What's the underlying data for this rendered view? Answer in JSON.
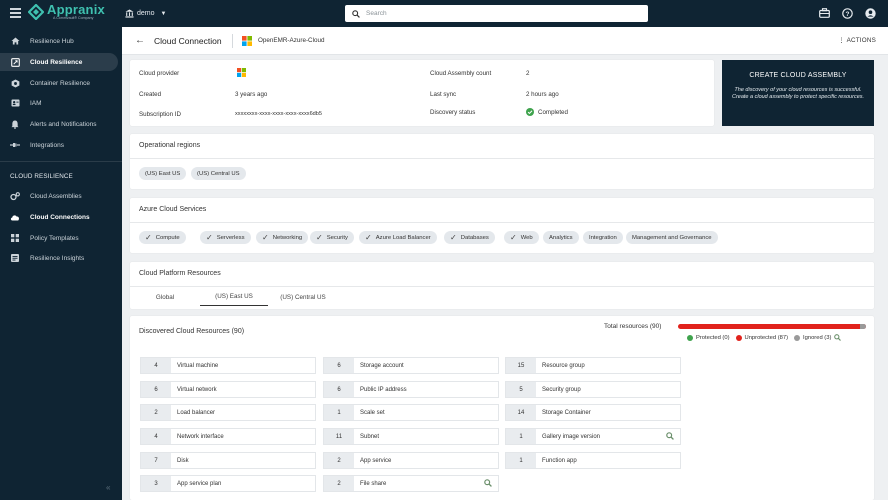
{
  "topbar": {
    "logo_name": "Appranix",
    "logo_sub": "A Commvault® Company",
    "tenant": "demo",
    "search_placeholder": "Search"
  },
  "sidebar": {
    "items": [
      {
        "label": "Resilience Hub",
        "icon": "home-icon"
      },
      {
        "label": "Cloud Resilience",
        "icon": "cloud-resilience-icon",
        "active": true
      },
      {
        "label": "Container Resilience",
        "icon": "container-icon"
      },
      {
        "label": "IAM",
        "icon": "id-badge-icon"
      },
      {
        "label": "Alerts and Notifications",
        "icon": "bell-icon"
      },
      {
        "label": "Integrations",
        "icon": "plug-icon"
      }
    ],
    "section_title": "CLOUD RESILIENCE",
    "section_items": [
      {
        "label": "Cloud Assemblies",
        "icon": "gears-icon"
      },
      {
        "label": "Cloud Connections",
        "icon": "cloud-icon",
        "active": true
      },
      {
        "label": "Policy Templates",
        "icon": "grid-icon"
      },
      {
        "label": "Resilience Insights",
        "icon": "insights-icon"
      }
    ],
    "collapse_glyph": "«"
  },
  "header": {
    "title": "Cloud Connection",
    "connection_name": "OpenEMR-Azure-Cloud",
    "actions_label": "ACTIONS"
  },
  "info": {
    "cloud_provider_label": "Cloud provider",
    "created_label": "Created",
    "created_value": "3 years ago",
    "subscription_label": "Subscription ID",
    "subscription_value": "xxxxxxxx-xxxx-xxxx-xxxx-xxxx6db5",
    "assembly_count_label": "Cloud Assembly count",
    "assembly_count_value": "2",
    "last_sync_label": "Last sync",
    "last_sync_value": "2 hours ago",
    "discovery_label": "Discovery status",
    "discovery_value": "Completed"
  },
  "create_assembly": {
    "title": "CREATE CLOUD ASSEMBLY",
    "description": "The discovery of your cloud resources is successful. Create a cloud assembly to protect specific resources."
  },
  "regions": {
    "title": "Operational regions",
    "items": [
      "(US) East US",
      "(US) Central US"
    ]
  },
  "services": {
    "title": "Azure Cloud Services",
    "checked": [
      "Compute",
      "Serverless",
      "Networking",
      "Security",
      "Azure Load Balancer",
      "Databases",
      "Web"
    ],
    "unchecked": [
      "Analytics",
      "Integration",
      "Management and Governance"
    ]
  },
  "platform": {
    "title": "Cloud Platform Resources",
    "tabs": [
      "Global",
      "(US) East US",
      "(US) Central US"
    ],
    "active_tab": "(US) East US"
  },
  "discovered": {
    "title": "Discovered Cloud Resources (90)",
    "total": "Total resources (90)",
    "protected": 0,
    "unprotected": 87,
    "ignored": 3,
    "legend": {
      "protected": "Protected (0)",
      "unprotected": "Unprotected (87)",
      "ignored": "Ignored (3)"
    },
    "colors": {
      "protected": "#3fa34d",
      "unprotected": "#e1221c",
      "ignored": "#9a9a9a"
    },
    "col1": [
      {
        "count": "4",
        "name": "Virtual machine"
      },
      {
        "count": "6",
        "name": "Virtual network"
      },
      {
        "count": "2",
        "name": "Load balancer"
      },
      {
        "count": "4",
        "name": "Network interface"
      },
      {
        "count": "7",
        "name": "Disk"
      },
      {
        "count": "3",
        "name": "App service plan"
      }
    ],
    "col2": [
      {
        "count": "6",
        "name": "Storage account"
      },
      {
        "count": "6",
        "name": "Public IP address"
      },
      {
        "count": "1",
        "name": "Scale set"
      },
      {
        "count": "11",
        "name": "Subnet"
      },
      {
        "count": "2",
        "name": "App service"
      },
      {
        "count": "2",
        "name": "File share",
        "magnifier": true
      }
    ],
    "col3": [
      {
        "count": "15",
        "name": "Resource group"
      },
      {
        "count": "5",
        "name": "Security group"
      },
      {
        "count": "14",
        "name": "Storage Container"
      },
      {
        "count": "1",
        "name": "Gallery image version",
        "magnifier": true
      },
      {
        "count": "1",
        "name": "Function app"
      }
    ]
  }
}
